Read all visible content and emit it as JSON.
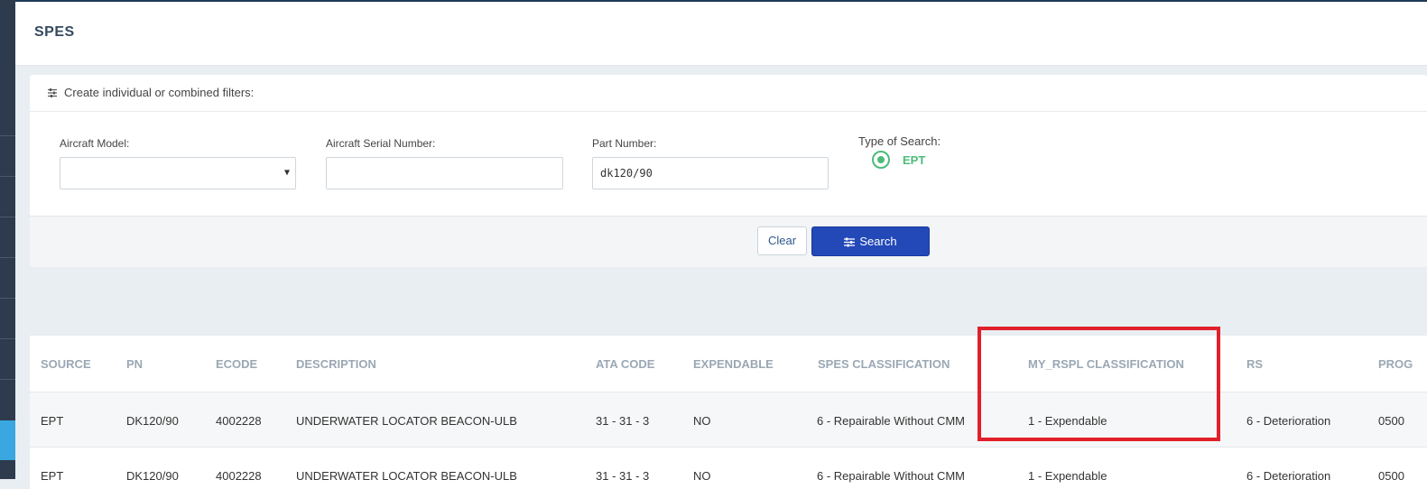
{
  "page": {
    "title": "SPES"
  },
  "filters": {
    "heading": "Create individual or combined filters:",
    "aircraft_model": {
      "label": "Aircraft Model:",
      "value": ""
    },
    "aircraft_serial": {
      "label": "Aircraft Serial Number:",
      "value": ""
    },
    "part_number": {
      "label": "Part Number:",
      "value": "dk120/90"
    },
    "search_type": {
      "label": "Type of Search:",
      "option": "EPT",
      "selected": true
    },
    "clear_label": "Clear",
    "search_label": "Search"
  },
  "table": {
    "columns": [
      "SOURCE",
      "PN",
      "ECODE",
      "DESCRIPTION",
      "ATA CODE",
      "EXPENDABLE",
      "SPES CLASSIFICATION",
      "MY_RSPL CLASSIFICATION",
      "RS",
      "PROG"
    ],
    "rows": [
      [
        "EPT",
        "DK120/90",
        "4002228",
        "UNDERWATER LOCATOR BEACON-ULB",
        "31 - 31 - 3",
        "NO",
        "6 - Repairable Without CMM",
        "1 - Expendable",
        "6 - Deterioration",
        "0500"
      ],
      [
        "EPT",
        "DK120/90",
        "4002228",
        "UNDERWATER LOCATOR BEACON-ULB",
        "31 - 31 - 3",
        "NO",
        "6 - Repairable Without CMM",
        "1 - Expendable",
        "6 - Deterioration",
        "0500"
      ]
    ]
  },
  "colors": {
    "accent": "#2348b8",
    "radio": "#4cbc7a",
    "highlight": "#e0202a",
    "sidebar": "#2e3b4e"
  }
}
